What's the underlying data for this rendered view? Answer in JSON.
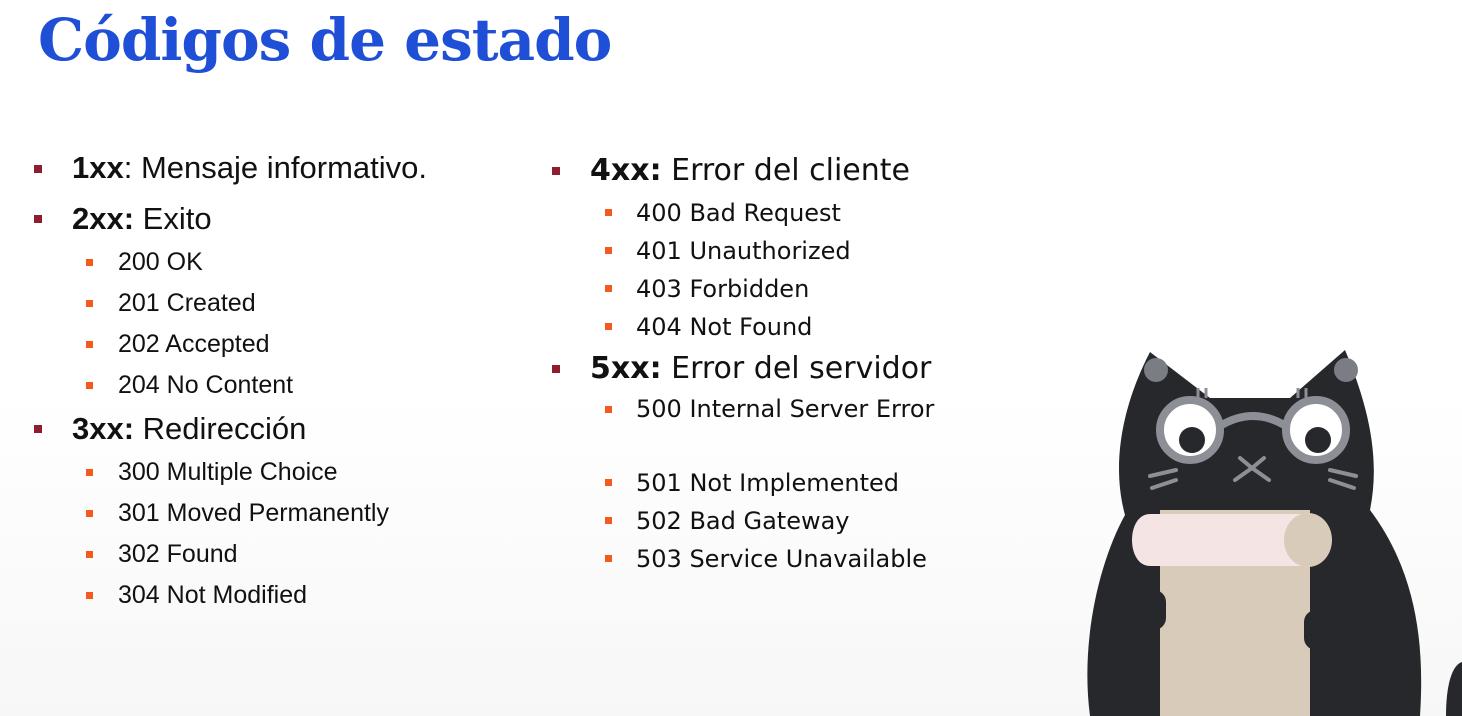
{
  "title": "Códigos de estado",
  "groups_left": [
    {
      "code": "1xx",
      "sep": ":",
      "label": " Mensaje informativo.",
      "items": []
    },
    {
      "code": "2xx:",
      "sep": "",
      "label": " Exito",
      "items": [
        "200 OK",
        "201 Created",
        "202 Accepted",
        "204 No Content"
      ]
    },
    {
      "code": "3xx:",
      "sep": "",
      "label": " Redirección",
      "items": [
        "300 Multiple Choice",
        "301 Moved Permanently",
        "302 Found",
        "304 Not Modified"
      ]
    }
  ],
  "groups_right": [
    {
      "code": "4xx:",
      "label": " Error del cliente",
      "items": [
        "400 Bad Request",
        "401 Unauthorized",
        "403 Forbidden",
        "404 Not Found"
      ]
    },
    {
      "code": "5xx:",
      "label": " Error del servidor",
      "items": [
        "500 Internal Server Error",
        "501 Not Implemented",
        "502 Bad Gateway",
        "503 Service Unavailable"
      ]
    }
  ],
  "colors": {
    "title": "#1e4fd6",
    "bullet_level1": "#8f1d2d",
    "bullet_level2": "#f25b1d",
    "cat_body": "#26282c",
    "scroll": "#d9cbb9",
    "scroll_top": "#f5e4e4"
  },
  "illustration": "cat-holding-scroll"
}
